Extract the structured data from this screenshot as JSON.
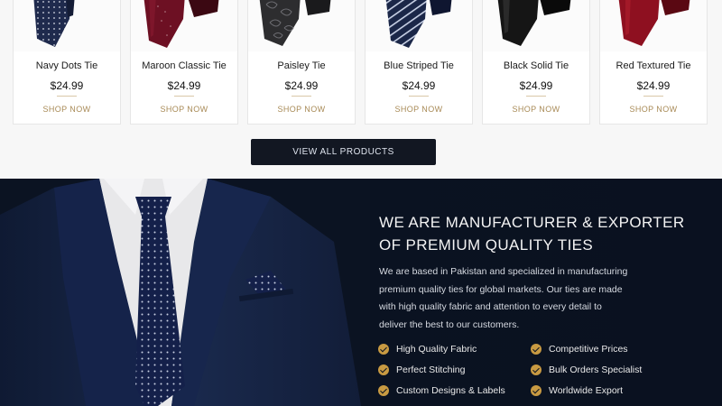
{
  "products": [
    {
      "name": "Navy Dots Tie",
      "price": "$24.99",
      "cta": "SHOP NOW",
      "color": "#1f2a4d"
    },
    {
      "name": "Maroon Classic Tie",
      "price": "$24.99",
      "cta": "SHOP NOW",
      "color": "#6d1023"
    },
    {
      "name": "Paisley Tie",
      "price": "$24.99",
      "cta": "SHOP NOW",
      "color": "#2d2d2f"
    },
    {
      "name": "Blue Striped Tie",
      "price": "$24.99",
      "cta": "SHOP NOW",
      "color": "#1b2748"
    },
    {
      "name": "Black Solid Tie",
      "price": "$24.99",
      "cta": "SHOP NOW",
      "color": "#151515"
    },
    {
      "name": "Red Textured Tie",
      "price": "$24.99",
      "cta": "SHOP NOW",
      "color": "#8e1020"
    }
  ],
  "view_all_label": "VIEW ALL PRODUCTS",
  "about": {
    "headline_line1": "WE ARE MANUFACTURER & EXPORTER",
    "headline_line2": "OF PREMIUM QUALITY TIES",
    "description_lines": [
      "We are based in Pakistan and specialized in manufacturing",
      "premium quality ties for global markets. Our ties are made",
      "with high quality fabric and attention to every detail to",
      "deliver the best to our customers."
    ],
    "features": [
      "High Quality Fabric",
      "Competitive Prices",
      "Perfect Stitching",
      "Bulk Orders Specialist",
      "Custom Designs & Labels",
      "Worldwide Export"
    ]
  },
  "colors": {
    "accent_gold": "#a88a56",
    "check_gold": "#c89a42",
    "dark_navy": "#0b1322",
    "button_dark": "#121722"
  }
}
